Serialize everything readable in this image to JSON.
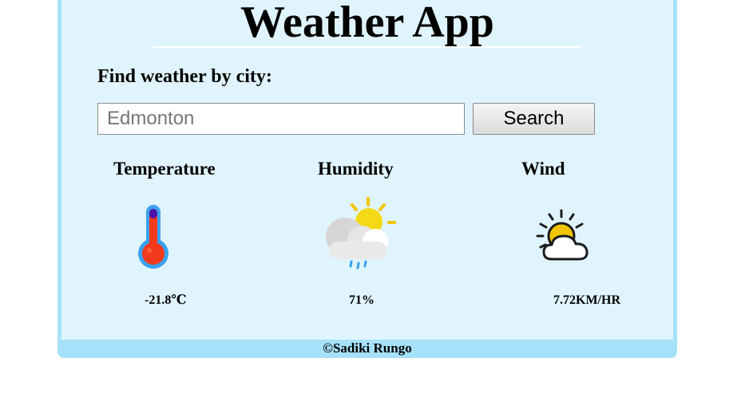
{
  "app": {
    "title": "Weather App",
    "footer": "©Sadiki Rungo"
  },
  "search": {
    "label": "Find weather by city:",
    "value": "Edmonton",
    "button_label": "Search"
  },
  "stats": {
    "temperature": {
      "heading": "Temperature",
      "value": "-21.8℃",
      "icon": "thermometer-icon"
    },
    "humidity": {
      "heading": "Humidity",
      "value": "71%",
      "icon": "rain-cloud-sun-icon"
    },
    "wind": {
      "heading": "Wind",
      "value": "7.72KM/HR",
      "icon": "sun-behind-cloud-icon"
    }
  },
  "colors": {
    "frame": "#a6e1fa",
    "panel": "#e0f4fd",
    "thermometer_fill": "#f33a1c",
    "thermometer_outline": "#3aa1ef",
    "sun": "#f2c500"
  }
}
